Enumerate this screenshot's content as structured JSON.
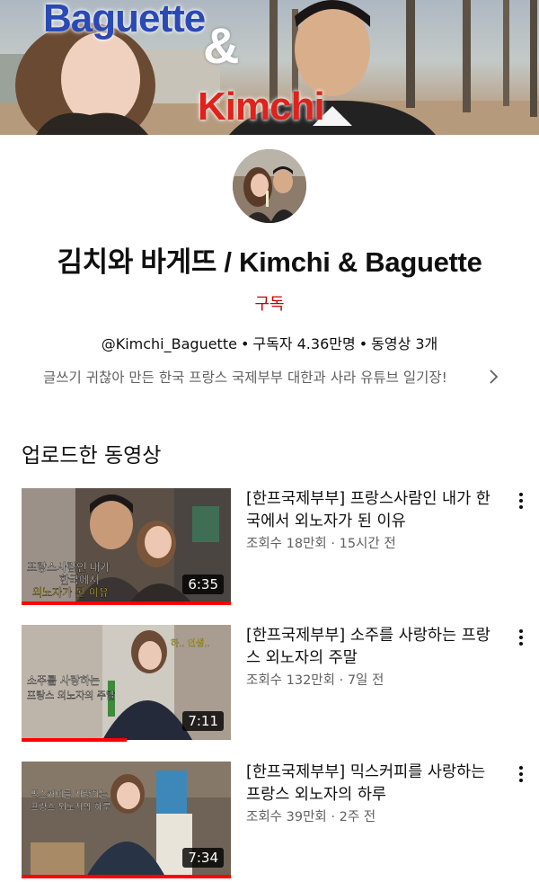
{
  "banner": {
    "word_top": "Baguette",
    "word_amp": "&",
    "word_bottom": "Kimchi"
  },
  "channel": {
    "name": "김치와 바게뜨 / Kimchi & Baguette",
    "subscribe_label": "구독",
    "handle": "@Kimchi_Baguette",
    "subscribers": "구독자 4.36만명",
    "video_count": "동영상 3개",
    "separator": "•",
    "description": "글쓰기 귀찮아 만든 한국 프랑스 국제부부 대한과 사라 유튜브 일기장!"
  },
  "section": {
    "title": "업로드한 동영상"
  },
  "videos": [
    {
      "title": "[한프국제부부] 프랑스사람인 내가 한국에서 외노자가 된 이유",
      "views": "조회수 18만회",
      "age": "15시간 전",
      "meta_sep": "·",
      "duration": "6:35",
      "progress": 1.0,
      "thumb_lines": [
        "프랑스사람인 내가",
        "한국에서",
        "외노자가 된 이유"
      ]
    },
    {
      "title": "[한프국제부부] 소주를 사랑하는 프랑스 외노자의 주말",
      "views": "조회수 132만회",
      "age": "7일 전",
      "meta_sep": "·",
      "duration": "7:11",
      "progress": 0.5,
      "thumb_lines": [
        "소주를 사랑하는",
        "프랑스 외노자의 주말",
        "하.. 인생.."
      ]
    },
    {
      "title": "[한프국제부부] 믹스커피를 사랑하는 프랑스 외노자의 하루",
      "views": "조회수 39만회",
      "age": "2주 전",
      "meta_sep": "·",
      "duration": "7:34",
      "progress": 1.0,
      "thumb_lines": [
        "믹스커피를 사랑하는",
        "프랑스 외노자의 하루"
      ]
    }
  ],
  "icons": {
    "chevron": "chevron-right-icon",
    "menu": "more-vert-icon"
  },
  "colors": {
    "subscribe": "#cc0000",
    "progress": "#ff0000",
    "secondary_text": "#606060"
  }
}
